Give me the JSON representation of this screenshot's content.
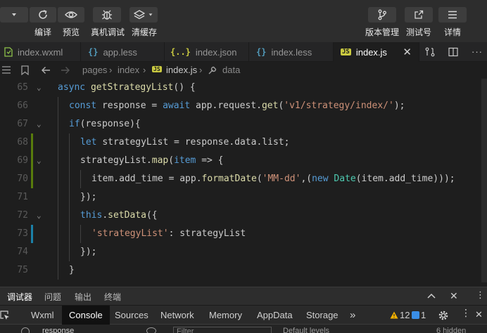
{
  "toolbar": {
    "left_buttons": [
      {
        "label": "编译",
        "icon": "compile-icon"
      },
      {
        "label": "预览",
        "icon": "preview-eye-icon"
      },
      {
        "label": "真机调试",
        "icon": "bug-icon"
      },
      {
        "label": "清缓存",
        "icon": "layers-icon"
      }
    ],
    "right_buttons": [
      {
        "label": "版本管理",
        "icon": "branch-icon"
      },
      {
        "label": "测试号",
        "icon": "external-link-icon"
      },
      {
        "label": "详情",
        "icon": "menu-icon"
      }
    ]
  },
  "editor_tabs": [
    {
      "name": "index.wxml",
      "icon_text": "",
      "icon_color": "#8dc149",
      "active": false
    },
    {
      "name": "app.less",
      "icon_text": "{}",
      "icon_color": "#519aba",
      "active": false
    },
    {
      "name": "index.json",
      "icon_text": "{..}",
      "icon_color": "#cbcb41",
      "active": false
    },
    {
      "name": "index.less",
      "icon_text": "{}",
      "icon_color": "#519aba",
      "active": false
    },
    {
      "name": "index.js",
      "icon_text": "JS",
      "icon_color": "#cbcb41",
      "active": true
    }
  ],
  "breadcrumb": {
    "items": [
      "pages",
      "index",
      "index.js",
      "data"
    ],
    "js_badge": "JS"
  },
  "code_lines": [
    {
      "num": "65",
      "indent": 0,
      "tokens": [
        [
          "async ",
          "kw"
        ],
        [
          "getStrategyList",
          "fn"
        ],
        [
          "() {",
          ""
        ]
      ]
    },
    {
      "num": "66",
      "indent": 1,
      "tokens": [
        [
          "const ",
          "kw"
        ],
        [
          "response = ",
          ""
        ],
        [
          "await ",
          "kw"
        ],
        [
          "app.request.",
          ""
        ],
        [
          "get",
          "fn"
        ],
        [
          "(",
          ""
        ],
        [
          "'v1/strategy/index/'",
          "str"
        ],
        [
          ");",
          ""
        ]
      ]
    },
    {
      "num": "67",
      "indent": 1,
      "tokens": [
        [
          "if",
          "kw"
        ],
        [
          "(response){",
          ""
        ]
      ]
    },
    {
      "num": "68",
      "indent": 2,
      "tokens": [
        [
          "let ",
          "kw"
        ],
        [
          "strategyList = response.data.list;",
          ""
        ]
      ]
    },
    {
      "num": "69",
      "indent": 2,
      "tokens": [
        [
          "strategyList.",
          ""
        ],
        [
          "map",
          "fn"
        ],
        [
          "(",
          ""
        ],
        [
          "item",
          "kw"
        ],
        [
          " => {",
          ""
        ]
      ]
    },
    {
      "num": "70",
      "indent": 3,
      "tokens": [
        [
          "item.add_time = app.",
          ""
        ],
        [
          "formatDate",
          "fn"
        ],
        [
          "(",
          ""
        ],
        [
          "'MM-dd'",
          "str"
        ],
        [
          ",(",
          ""
        ],
        [
          "new ",
          "kw"
        ],
        [
          "Date",
          "cls"
        ],
        [
          "(item.add_time)));",
          ""
        ]
      ]
    },
    {
      "num": "71",
      "indent": 2,
      "tokens": [
        [
          "});",
          ""
        ]
      ]
    },
    {
      "num": "72",
      "indent": 2,
      "tokens": [
        [
          "this",
          "kw"
        ],
        [
          ".",
          ""
        ],
        [
          "setData",
          "fn"
        ],
        [
          "({",
          ""
        ]
      ]
    },
    {
      "num": "73",
      "indent": 3,
      "tokens": [
        [
          "'strategyList'",
          "str"
        ],
        [
          ": strategyList",
          ""
        ]
      ]
    },
    {
      "num": "74",
      "indent": 2,
      "tokens": [
        [
          "});",
          ""
        ]
      ]
    },
    {
      "num": "75",
      "indent": 1,
      "tokens": [
        [
          "}",
          ""
        ]
      ]
    }
  ],
  "devtools": {
    "top_tabs": [
      "调试器",
      "问题",
      "输出",
      "终端"
    ],
    "panel_tabs": [
      "Wxml",
      "Console",
      "Sources",
      "Network",
      "Memory",
      "AppData",
      "Storage"
    ],
    "more": "»",
    "warning_count": "12",
    "info_count": "1",
    "console_filter_value": "response",
    "filter_placeholder": "Filter",
    "levels_label": "Default levels",
    "hidden_label": "6 hidden"
  },
  "colors": {
    "keyword": "#569cd6",
    "function": "#dcdcaa",
    "string": "#ce9178",
    "class": "#4ec9b0",
    "added": "#587c0c",
    "modified": "#1b81a8"
  }
}
